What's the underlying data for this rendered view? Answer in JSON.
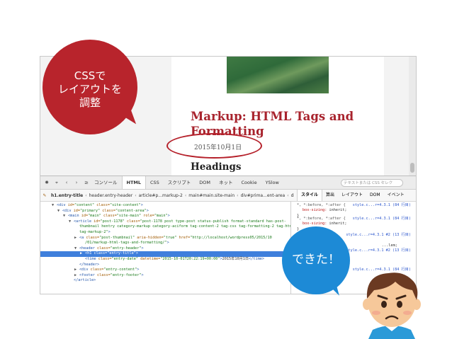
{
  "callouts": {
    "css_adjust": [
      "CSSで",
      "レイアウトを",
      "調整"
    ],
    "done": "できた！"
  },
  "page": {
    "post_title": "Markup: HTML Tags and Formatting",
    "post_date": "2015年10月1日",
    "heading": "Headings"
  },
  "devtools": {
    "tabs": [
      "コンソール",
      "HTML",
      "CSS",
      "スクリプト",
      "DOM",
      "ネット",
      "Cookie",
      "YSlow"
    ],
    "active_tab": "HTML",
    "search_placeholder": "テキストまたは CSS セレク",
    "breadcrumbs": [
      "h1.entry-title",
      "header.entry-header",
      "article#p...markup-2",
      "main#main.site-main",
      "div#prima...ent-area",
      "div#"
    ],
    "pane_tabs": [
      "スタイル",
      "算出",
      "レイアウト",
      "DOM",
      "イベント"
    ],
    "active_pane_tab": "スタイル",
    "tree_lines": [
      {
        "indent": 2,
        "tw": "▼",
        "parts": [
          [
            "tag",
            "<div "
          ],
          [
            "attr",
            "id="
          ],
          [
            "val",
            "\"content\""
          ],
          [
            "attr",
            " class="
          ],
          [
            "val",
            "\"site-content\""
          ],
          [
            "tag",
            ">"
          ]
        ]
      },
      {
        "indent": 3,
        "tw": "▼",
        "parts": [
          [
            "tag",
            "<div "
          ],
          [
            "attr",
            "id="
          ],
          [
            "val",
            "\"primary\""
          ],
          [
            "attr",
            " class="
          ],
          [
            "val",
            "\"content-area\""
          ],
          [
            "tag",
            ">"
          ]
        ]
      },
      {
        "indent": 4,
        "tw": "▼",
        "parts": [
          [
            "tag",
            "<main "
          ],
          [
            "attr",
            "id="
          ],
          [
            "val",
            "\"main\""
          ],
          [
            "attr",
            " class="
          ],
          [
            "val",
            "\"site-main\""
          ],
          [
            "attr",
            " role="
          ],
          [
            "val",
            "\"main\""
          ],
          [
            "tag",
            ">"
          ]
        ]
      },
      {
        "indent": 5,
        "tw": "▼",
        "parts": [
          [
            "tag",
            "<article "
          ],
          [
            "attr",
            "id="
          ],
          [
            "val",
            "\"post-1178\""
          ],
          [
            "attr",
            " class="
          ],
          [
            "val",
            "\"post-1178 post type-post status-publish format-standard has-post-"
          ],
          [
            "tag",
            ""
          ]
        ]
      },
      {
        "indent": 6,
        "tw": "",
        "parts": [
          [
            "val",
            "thumbnail hentry category-markup category-aciform tag-content-2 tag-css tag-formatting-2 tag-html"
          ]
        ]
      },
      {
        "indent": 6,
        "tw": "",
        "parts": [
          [
            "val",
            "tag-markup-2\""
          ],
          [
            "tag",
            ">"
          ]
        ]
      },
      {
        "indent": 6,
        "tw": "▶",
        "parts": [
          [
            "tag",
            "<a "
          ],
          [
            "attr",
            "class="
          ],
          [
            "val",
            "\"post-thumbnail\""
          ],
          [
            "attr",
            " aria-hidden="
          ],
          [
            "val",
            "\"true\""
          ],
          [
            "attr",
            " href="
          ],
          [
            "val",
            "\"http://localhost/wordpress05/2015/10"
          ]
        ]
      },
      {
        "indent": 7,
        "tw": "",
        "parts": [
          [
            "val",
            "/01/markup-html-tags-and-formatting/\""
          ],
          [
            "tag",
            ">"
          ]
        ]
      },
      {
        "indent": 6,
        "tw": "▼",
        "parts": [
          [
            "tag",
            "<header "
          ],
          [
            "attr",
            "class="
          ],
          [
            "val",
            "\"entry-header\""
          ],
          [
            "tag",
            ">"
          ]
        ]
      },
      {
        "indent": 7,
        "tw": "▶",
        "sel": true,
        "parts": [
          [
            "tag",
            "<h1 "
          ],
          [
            "attr",
            "class="
          ],
          [
            "val",
            "\"entry-title\""
          ],
          [
            "tag",
            ">"
          ]
        ]
      },
      {
        "indent": 7,
        "tw": "",
        "parts": [
          [
            "tag",
            "<time "
          ],
          [
            "attr",
            "class="
          ],
          [
            "val",
            "\"entry-date\""
          ],
          [
            "attr",
            " datetime="
          ],
          [
            "val",
            "\"2015-10-01T20:22:19+00:00\""
          ],
          [
            "tag",
            ">"
          ],
          [
            "plain",
            "2015年10月1日"
          ],
          [
            "tag",
            "</time>"
          ]
        ]
      },
      {
        "indent": 6,
        "tw": "",
        "parts": [
          [
            "tag",
            "</header>"
          ]
        ]
      },
      {
        "indent": 6,
        "tw": "▶",
        "parts": [
          [
            "tag",
            "<div "
          ],
          [
            "attr",
            "class="
          ],
          [
            "val",
            "\"entry-content\""
          ],
          [
            "tag",
            ">"
          ]
        ]
      },
      {
        "indent": 6,
        "tw": "▶",
        "parts": [
          [
            "tag",
            "<footer "
          ],
          [
            "attr",
            "class="
          ],
          [
            "val",
            "\"entry-footer\""
          ],
          [
            "tag",
            ">"
          ]
        ]
      },
      {
        "indent": 5,
        "tw": "",
        "parts": [
          [
            "tag",
            "</article>"
          ]
        ]
      }
    ],
    "style_rules": [
      {
        "selector": "*, *:before, *:after {",
        "decls": [
          [
            "box-sizing",
            "inherit;"
          ]
        ],
        "close": "}",
        "source": "style.c...r=4.3.1 (84 行目)"
      },
      {
        "selector": "*, *:before, *:after {",
        "decls": [
          [
            "box-sizing",
            "inherit;"
          ]
        ],
        "close": "}",
        "source": "style.c...r=4.3.1 (84 行目)"
      },
      {
        "selector": "",
        "decls": [],
        "close": "",
        "source": "style.c...r=4.3.1 #2 (13 行目)"
      },
      {
        "selector": "",
        "decls": [
          [
            "",
            "...lem;"
          ]
        ],
        "close": "",
        "source": ""
      },
      {
        "selector": "",
        "decls": [],
        "close": "",
        "source": "style.c...r=4.3.1 #2 (13 行目)"
      },
      {
        "selector": "",
        "decls": [],
        "close": "",
        "source": "style.c...r=4.3.1 (84 行目)"
      }
    ]
  }
}
